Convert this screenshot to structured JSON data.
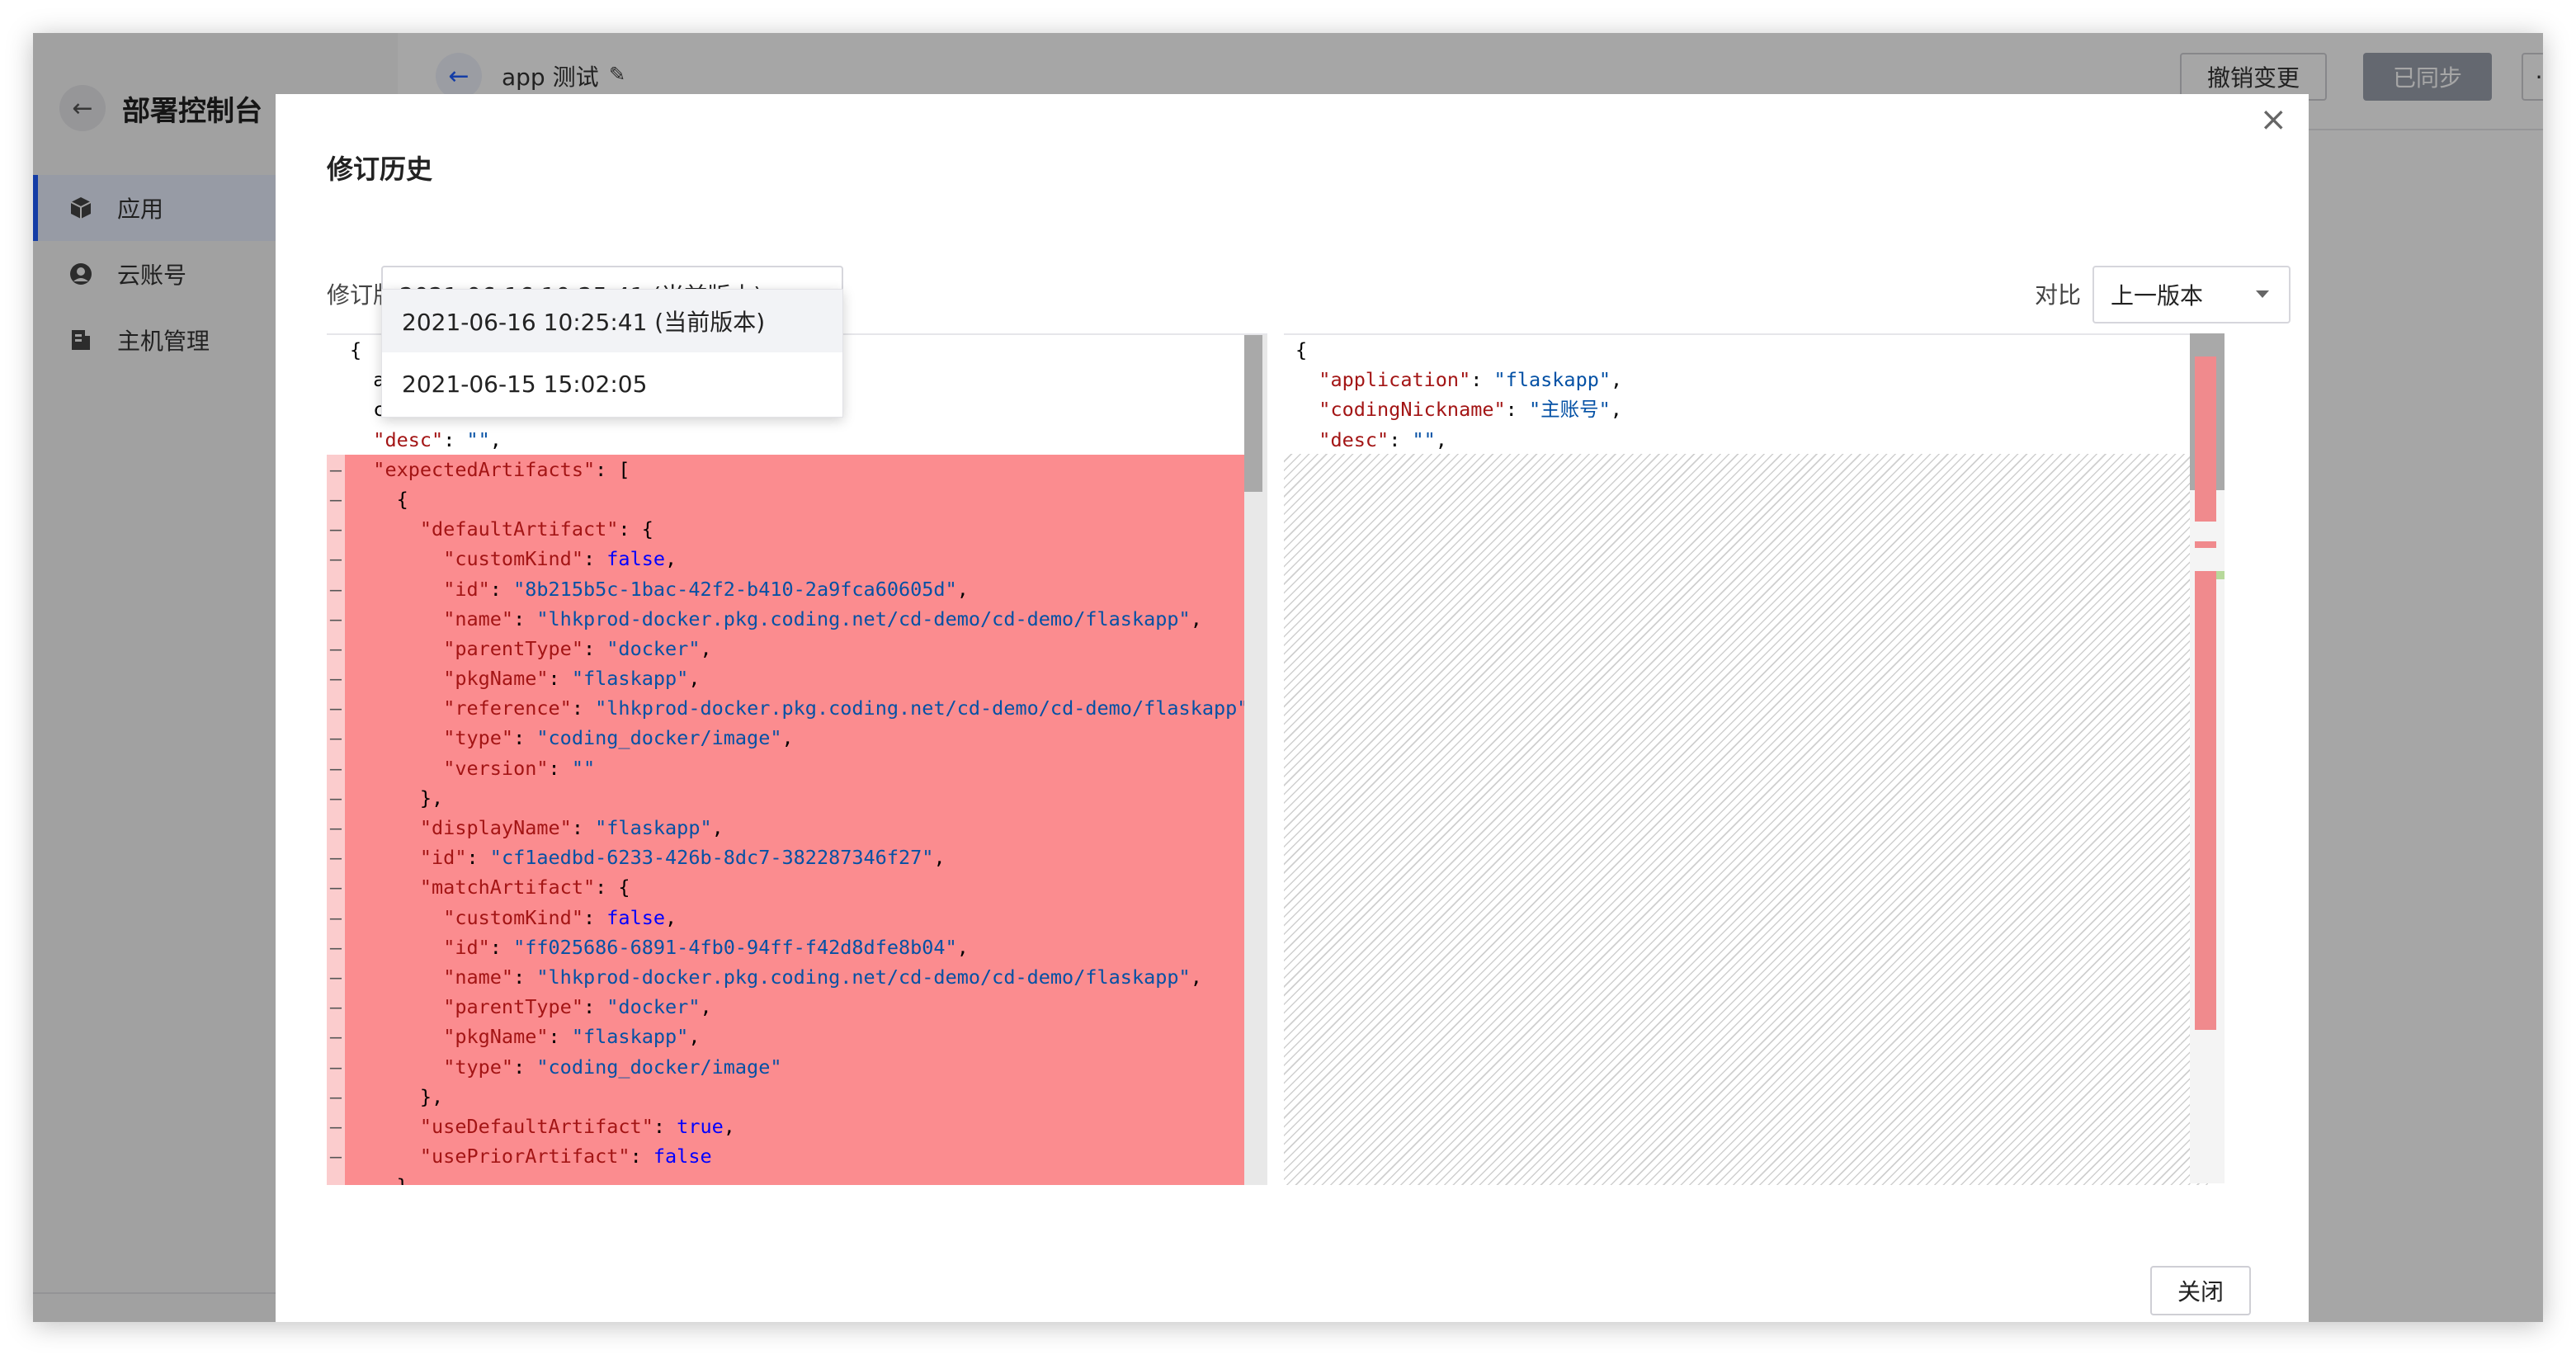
{
  "sidebar": {
    "title": "部署控制台",
    "items": [
      {
        "label": "应用",
        "icon": "cube-icon",
        "active": true
      },
      {
        "label": "云账号",
        "icon": "user-circle-icon",
        "active": false
      },
      {
        "label": "主机管理",
        "icon": "server-icon",
        "active": false
      }
    ]
  },
  "topbar": {
    "app_name": "app 测试",
    "revert_label": "撤销变更",
    "synced_label": "已同步",
    "more_label": "···"
  },
  "modal": {
    "title": "修订历史",
    "revision_label": "修订版本",
    "revision_selected": "2021-06-16 10:25:41 (当前版本)",
    "compare_label": "对比",
    "compare_selected": "上一版本",
    "close_label": "关闭",
    "close_icon": "close-icon",
    "dropdown_options": [
      "2021-06-16 10:25:41 (当前版本)",
      "2021-06-15 15:02:05"
    ]
  },
  "diff": {
    "left_lines": [
      {
        "text": "{",
        "deleted": false
      },
      {
        "text": "  \"appl",
        "deleted": false
      },
      {
        "text": "  \"codin",
        "deleted": false
      },
      {
        "text": "  \"desc\": \"\",",
        "deleted": false
      },
      {
        "text": "  \"expectedArtifacts\": [",
        "deleted": true
      },
      {
        "text": "    {",
        "deleted": true
      },
      {
        "text": "      \"defaultArtifact\": {",
        "deleted": true
      },
      {
        "text": "        \"customKind\": false,",
        "deleted": true
      },
      {
        "text": "        \"id\": \"8b215b5c-1bac-42f2-b410-2a9fca60605d\",",
        "deleted": true
      },
      {
        "text": "        \"name\": \"lhkprod-docker.pkg.coding.net/cd-demo/cd-demo/flaskapp\",",
        "deleted": true
      },
      {
        "text": "        \"parentType\": \"docker\",",
        "deleted": true
      },
      {
        "text": "        \"pkgName\": \"flaskapp\",",
        "deleted": true
      },
      {
        "text": "        \"reference\": \"lhkprod-docker.pkg.coding.net/cd-demo/cd-demo/flaskapp\"",
        "deleted": true
      },
      {
        "text": "        \"type\": \"coding_docker/image\",",
        "deleted": true
      },
      {
        "text": "        \"version\": \"\"",
        "deleted": true
      },
      {
        "text": "      },",
        "deleted": true
      },
      {
        "text": "      \"displayName\": \"flaskapp\",",
        "deleted": true
      },
      {
        "text": "      \"id\": \"cf1aedbd-6233-426b-8dc7-382287346f27\",",
        "deleted": true
      },
      {
        "text": "      \"matchArtifact\": {",
        "deleted": true
      },
      {
        "text": "        \"customKind\": false,",
        "deleted": true
      },
      {
        "text": "        \"id\": \"ff025686-6891-4fb0-94ff-f42d8dfe8b04\",",
        "deleted": true
      },
      {
        "text": "        \"name\": \"lhkprod-docker.pkg.coding.net/cd-demo/cd-demo/flaskapp\",",
        "deleted": true
      },
      {
        "text": "        \"parentType\": \"docker\",",
        "deleted": true
      },
      {
        "text": "        \"pkgName\": \"flaskapp\",",
        "deleted": true
      },
      {
        "text": "        \"type\": \"coding_docker/image\"",
        "deleted": true
      },
      {
        "text": "      },",
        "deleted": true
      },
      {
        "text": "      \"useDefaultArtifact\": true,",
        "deleted": true
      },
      {
        "text": "      \"usePriorArtifact\": false",
        "deleted": true
      },
      {
        "text": "    }",
        "deleted": true
      }
    ],
    "right_lines": [
      {
        "text": "{"
      },
      {
        "text": "  \"application\": \"flaskapp\","
      },
      {
        "text": "  \"codingNickname\": \"主账号\","
      },
      {
        "text": "  \"desc\": \"\","
      }
    ],
    "colors": {
      "deleted_line": "#fb8c8f",
      "deleted_gutter": "#fbcccd",
      "added_marker": "#b7d99b",
      "key": "#a31515",
      "string": "#0451a5",
      "boolean": "#0000ff"
    }
  }
}
